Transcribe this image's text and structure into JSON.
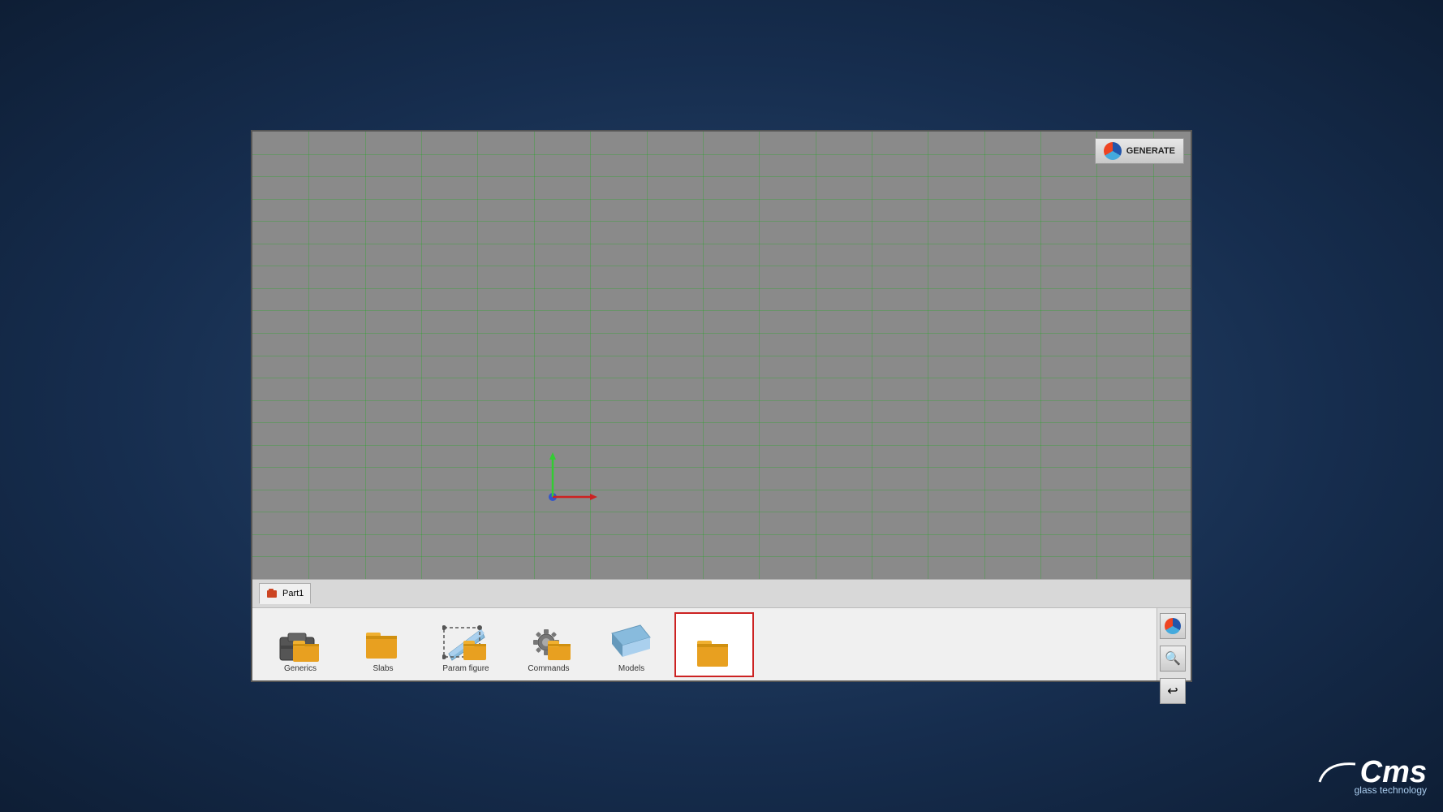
{
  "app": {
    "title": "CMS Glass Technology",
    "generate_label": "GENERATE",
    "viewport_bg": "#8a8a8a"
  },
  "tab_bar": {
    "items": [
      {
        "label": "Part1",
        "active": true
      }
    ]
  },
  "toolbar": {
    "items": [
      {
        "id": "generics",
        "label": "Generics"
      },
      {
        "id": "slabs",
        "label": "Slabs"
      },
      {
        "id": "paramfig",
        "label": "Param figure"
      },
      {
        "id": "commands",
        "label": "Commands"
      },
      {
        "id": "models",
        "label": "Models"
      },
      {
        "id": "sixth",
        "label": ""
      }
    ]
  },
  "right_toolbar": {
    "buttons": [
      {
        "id": "search",
        "icon": "🔍"
      },
      {
        "id": "undo",
        "icon": "↩"
      }
    ]
  },
  "cms": {
    "name": "Cms",
    "subtitle": "glass technology"
  },
  "grid": {
    "columns": 14,
    "rows": 10
  }
}
